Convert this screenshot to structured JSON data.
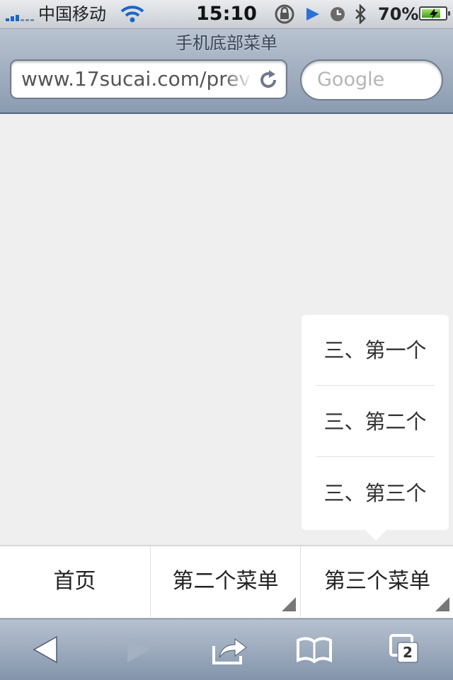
{
  "status_bar": {
    "carrier": "中国移动",
    "time": "15:10",
    "battery_percent": "70%",
    "battery_level": 0.7,
    "icons": [
      "signal-icon",
      "wifi-icon",
      "rotation-lock-icon",
      "play-icon",
      "clock-icon",
      "bluetooth-icon",
      "battery-charging-icon"
    ]
  },
  "browser": {
    "page_title": "手机底部菜单",
    "url": "www.17sucai.com/preview",
    "search_placeholder": "Google",
    "tabs_count": "2",
    "icons": [
      "reload-icon",
      "back-icon",
      "forward-icon",
      "share-icon",
      "bookmarks-icon",
      "tabs-icon"
    ]
  },
  "popup_menu": {
    "items": [
      {
        "label": "三、第一个"
      },
      {
        "label": "三、第二个"
      },
      {
        "label": "三、第三个"
      }
    ]
  },
  "bottom_menu": {
    "items": [
      {
        "label": "首页",
        "has_submenu": false
      },
      {
        "label": "第二个菜单",
        "has_submenu": true
      },
      {
        "label": "第三个菜单",
        "has_submenu": true,
        "active": true
      }
    ]
  },
  "colors": {
    "accent_blue": "#1a66c8",
    "battery_green": "#3f9c1a",
    "page_background": "#efefef",
    "toolbar_blue": "#8394ab"
  }
}
